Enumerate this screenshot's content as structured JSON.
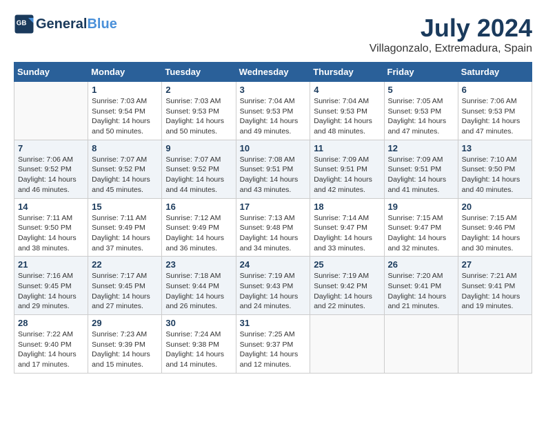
{
  "header": {
    "logo_line1": "General",
    "logo_line2": "Blue",
    "month_year": "July 2024",
    "location": "Villagonzalo, Extremadura, Spain"
  },
  "days_of_week": [
    "Sunday",
    "Monday",
    "Tuesday",
    "Wednesday",
    "Thursday",
    "Friday",
    "Saturday"
  ],
  "weeks": [
    [
      {
        "day": "",
        "info": ""
      },
      {
        "day": "1",
        "info": "Sunrise: 7:03 AM\nSunset: 9:54 PM\nDaylight: 14 hours\nand 50 minutes."
      },
      {
        "day": "2",
        "info": "Sunrise: 7:03 AM\nSunset: 9:53 PM\nDaylight: 14 hours\nand 50 minutes."
      },
      {
        "day": "3",
        "info": "Sunrise: 7:04 AM\nSunset: 9:53 PM\nDaylight: 14 hours\nand 49 minutes."
      },
      {
        "day": "4",
        "info": "Sunrise: 7:04 AM\nSunset: 9:53 PM\nDaylight: 14 hours\nand 48 minutes."
      },
      {
        "day": "5",
        "info": "Sunrise: 7:05 AM\nSunset: 9:53 PM\nDaylight: 14 hours\nand 47 minutes."
      },
      {
        "day": "6",
        "info": "Sunrise: 7:06 AM\nSunset: 9:53 PM\nDaylight: 14 hours\nand 47 minutes."
      }
    ],
    [
      {
        "day": "7",
        "info": "Sunrise: 7:06 AM\nSunset: 9:52 PM\nDaylight: 14 hours\nand 46 minutes."
      },
      {
        "day": "8",
        "info": "Sunrise: 7:07 AM\nSunset: 9:52 PM\nDaylight: 14 hours\nand 45 minutes."
      },
      {
        "day": "9",
        "info": "Sunrise: 7:07 AM\nSunset: 9:52 PM\nDaylight: 14 hours\nand 44 minutes."
      },
      {
        "day": "10",
        "info": "Sunrise: 7:08 AM\nSunset: 9:51 PM\nDaylight: 14 hours\nand 43 minutes."
      },
      {
        "day": "11",
        "info": "Sunrise: 7:09 AM\nSunset: 9:51 PM\nDaylight: 14 hours\nand 42 minutes."
      },
      {
        "day": "12",
        "info": "Sunrise: 7:09 AM\nSunset: 9:51 PM\nDaylight: 14 hours\nand 41 minutes."
      },
      {
        "day": "13",
        "info": "Sunrise: 7:10 AM\nSunset: 9:50 PM\nDaylight: 14 hours\nand 40 minutes."
      }
    ],
    [
      {
        "day": "14",
        "info": "Sunrise: 7:11 AM\nSunset: 9:50 PM\nDaylight: 14 hours\nand 38 minutes."
      },
      {
        "day": "15",
        "info": "Sunrise: 7:11 AM\nSunset: 9:49 PM\nDaylight: 14 hours\nand 37 minutes."
      },
      {
        "day": "16",
        "info": "Sunrise: 7:12 AM\nSunset: 9:49 PM\nDaylight: 14 hours\nand 36 minutes."
      },
      {
        "day": "17",
        "info": "Sunrise: 7:13 AM\nSunset: 9:48 PM\nDaylight: 14 hours\nand 34 minutes."
      },
      {
        "day": "18",
        "info": "Sunrise: 7:14 AM\nSunset: 9:47 PM\nDaylight: 14 hours\nand 33 minutes."
      },
      {
        "day": "19",
        "info": "Sunrise: 7:15 AM\nSunset: 9:47 PM\nDaylight: 14 hours\nand 32 minutes."
      },
      {
        "day": "20",
        "info": "Sunrise: 7:15 AM\nSunset: 9:46 PM\nDaylight: 14 hours\nand 30 minutes."
      }
    ],
    [
      {
        "day": "21",
        "info": "Sunrise: 7:16 AM\nSunset: 9:45 PM\nDaylight: 14 hours\nand 29 minutes."
      },
      {
        "day": "22",
        "info": "Sunrise: 7:17 AM\nSunset: 9:45 PM\nDaylight: 14 hours\nand 27 minutes."
      },
      {
        "day": "23",
        "info": "Sunrise: 7:18 AM\nSunset: 9:44 PM\nDaylight: 14 hours\nand 26 minutes."
      },
      {
        "day": "24",
        "info": "Sunrise: 7:19 AM\nSunset: 9:43 PM\nDaylight: 14 hours\nand 24 minutes."
      },
      {
        "day": "25",
        "info": "Sunrise: 7:19 AM\nSunset: 9:42 PM\nDaylight: 14 hours\nand 22 minutes."
      },
      {
        "day": "26",
        "info": "Sunrise: 7:20 AM\nSunset: 9:41 PM\nDaylight: 14 hours\nand 21 minutes."
      },
      {
        "day": "27",
        "info": "Sunrise: 7:21 AM\nSunset: 9:41 PM\nDaylight: 14 hours\nand 19 minutes."
      }
    ],
    [
      {
        "day": "28",
        "info": "Sunrise: 7:22 AM\nSunset: 9:40 PM\nDaylight: 14 hours\nand 17 minutes."
      },
      {
        "day": "29",
        "info": "Sunrise: 7:23 AM\nSunset: 9:39 PM\nDaylight: 14 hours\nand 15 minutes."
      },
      {
        "day": "30",
        "info": "Sunrise: 7:24 AM\nSunset: 9:38 PM\nDaylight: 14 hours\nand 14 minutes."
      },
      {
        "day": "31",
        "info": "Sunrise: 7:25 AM\nSunset: 9:37 PM\nDaylight: 14 hours\nand 12 minutes."
      },
      {
        "day": "",
        "info": ""
      },
      {
        "day": "",
        "info": ""
      },
      {
        "day": "",
        "info": ""
      }
    ]
  ]
}
